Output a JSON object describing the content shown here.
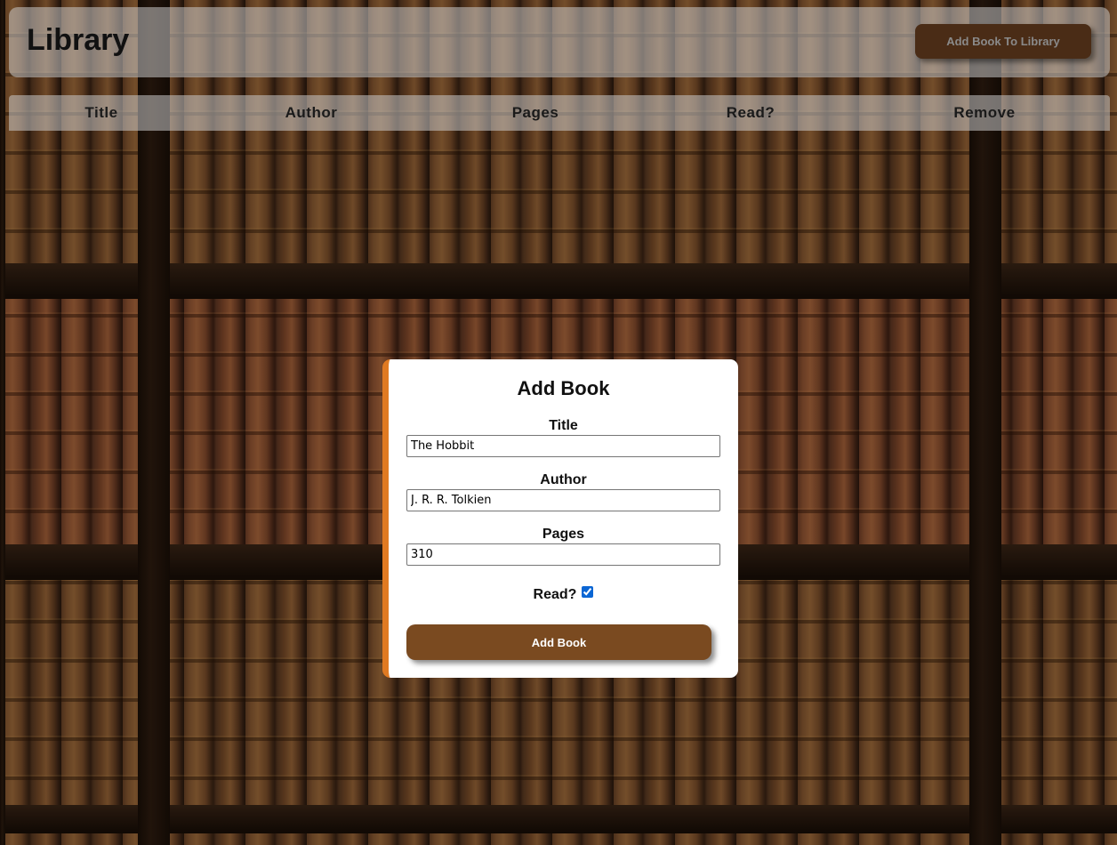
{
  "header": {
    "title": "Library",
    "add_button_label": "Add Book To Library"
  },
  "table": {
    "columns": [
      "Title",
      "Author",
      "Pages",
      "Read?",
      "Remove"
    ]
  },
  "modal": {
    "title": "Add Book",
    "fields": {
      "title": {
        "label": "Title",
        "value": "The Hobbit"
      },
      "author": {
        "label": "Author",
        "value": "J. R. R. Tolkien"
      },
      "pages": {
        "label": "Pages",
        "value": "310"
      }
    },
    "read": {
      "label": "Read?",
      "checked": true
    },
    "submit_label": "Add Book"
  },
  "colors": {
    "accent": "#e07a22",
    "button_brown": "#7a4a20",
    "header_button": "#4a2c16"
  },
  "icons": {
    "read_checkbox": "checkbox-checked-icon"
  }
}
